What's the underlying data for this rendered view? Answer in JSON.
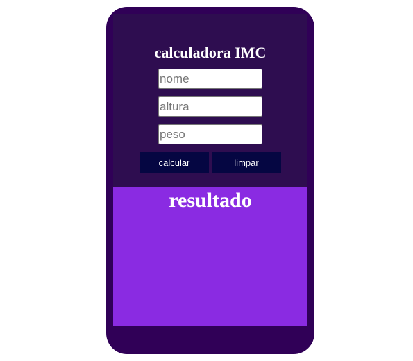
{
  "app": {
    "title": "calculadora IMC"
  },
  "form": {
    "name_placeholder": "nome",
    "height_placeholder": "altura",
    "weight_placeholder": "peso",
    "name_value": "",
    "height_value": "",
    "weight_value": "",
    "calculate_label": "calcular",
    "clear_label": "limpar"
  },
  "result": {
    "title": "resultado"
  },
  "colors": {
    "frame": "#300057",
    "top_panel": "#2e0d50",
    "result_panel": "#8a2be2",
    "button": "#050642",
    "text": "#ffffff"
  }
}
